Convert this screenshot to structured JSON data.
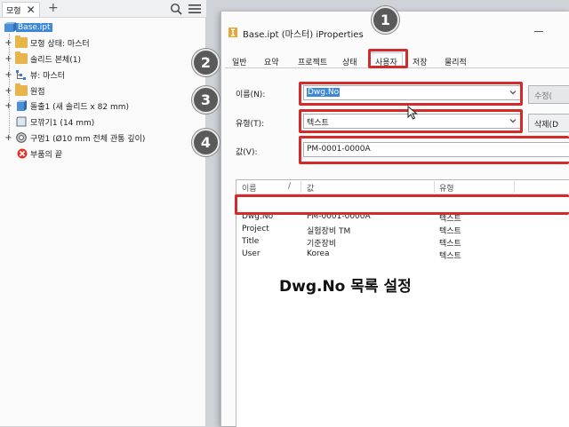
{
  "browser": {
    "tab_label": "모형",
    "tab_close": "✕",
    "tab_add": "+",
    "tree": [
      {
        "label": "Base.ipt",
        "icon": "part-icon",
        "expander": "",
        "selected": true
      },
      {
        "label": "모형 상태: 마스터",
        "icon": "folder-icon",
        "expander": "+"
      },
      {
        "label": "솔리드 본체(1)",
        "icon": "folder-icon",
        "expander": "+"
      },
      {
        "label": "뷰: 마스터",
        "icon": "view-icon",
        "expander": "+"
      },
      {
        "label": "원점",
        "icon": "folder-icon",
        "expander": "+"
      },
      {
        "label": "돌출1 (새 솔리드 x 82 mm)",
        "icon": "extrude-icon",
        "expander": "+"
      },
      {
        "label": "모깎기1 (14 mm)",
        "icon": "fillet-icon",
        "expander": ""
      },
      {
        "label": "구멍1 (Ø10 mm 전체 관통 깊이)",
        "icon": "hole-icon",
        "expander": "+"
      },
      {
        "label": "부품의 끝",
        "icon": "end-of-part-icon",
        "expander": ""
      }
    ]
  },
  "dialog": {
    "title": "Base.ipt (마스터) iProperties",
    "tabs": [
      "일반",
      "요약",
      "프로젝트",
      "상태",
      "사용자",
      "저장",
      "물리적"
    ],
    "active_tab": "사용자",
    "name_label": "이름(N):",
    "name_value": "Dwg.No",
    "type_label": "유형(T):",
    "type_value": "텍스트",
    "value_label": "값(V):",
    "value_value": "PM-0001-0000A",
    "modify_button": "수정(",
    "delete_button": "삭제(D",
    "list_headers": [
      "이름",
      "/",
      "값",
      "유형"
    ],
    "list_rows": [
      {
        "name": "Dwg.No",
        "value": "PM-0001-0000A",
        "type": "텍스트"
      },
      {
        "name": "Project",
        "value": "실험장비 TM",
        "type": "텍스트"
      },
      {
        "name": "Title",
        "value": "기준장비",
        "type": "텍스트"
      },
      {
        "name": "User",
        "value": "Korea",
        "type": "텍스트"
      }
    ]
  },
  "annotations": {
    "badges": [
      "1",
      "2",
      "3",
      "4"
    ],
    "caption": "Dwg.No 목록 설정",
    "highlight_color": "#d42a2a"
  }
}
